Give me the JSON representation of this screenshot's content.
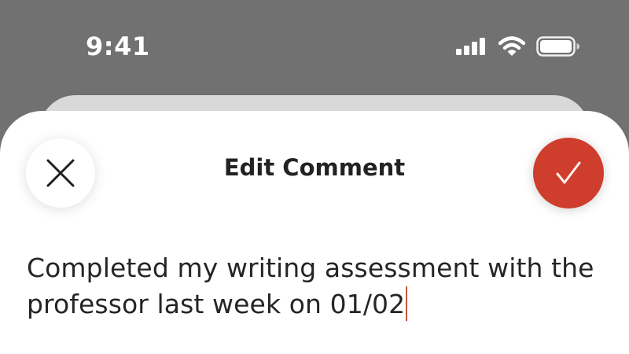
{
  "status_bar": {
    "time": "9:41",
    "icons": [
      "cellular-signal-icon",
      "wifi-icon",
      "battery-icon"
    ]
  },
  "sheet": {
    "title": "Edit Comment",
    "close_icon": "close-icon",
    "confirm_icon": "checkmark-icon"
  },
  "comment": {
    "text": "Completed my writing assessment with the professor last week on 01/02"
  },
  "colors": {
    "backdrop": "#717171",
    "accent": "#cf3d2c",
    "caret": "#c9553f",
    "text": "#252525"
  }
}
